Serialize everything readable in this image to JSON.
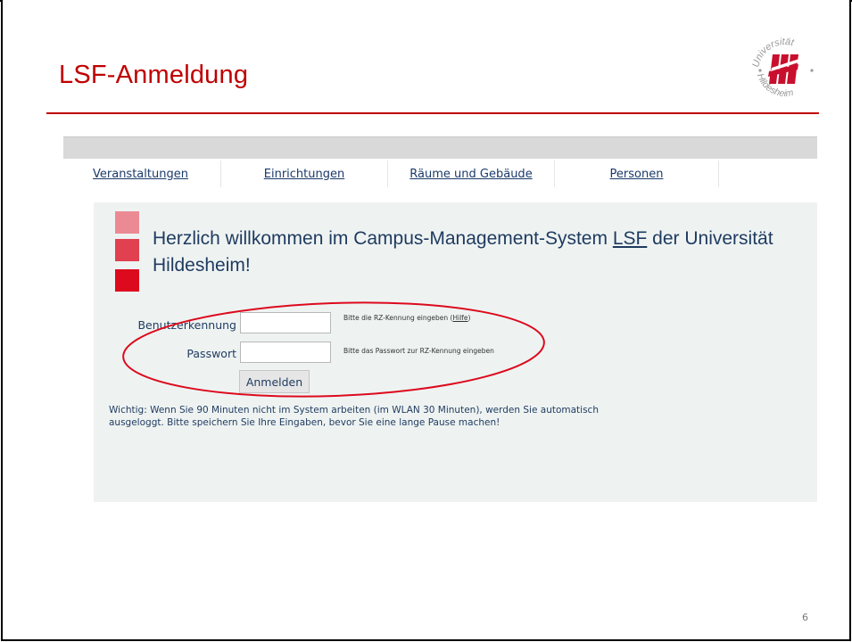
{
  "slide": {
    "title": "LSF-Anmeldung",
    "page_number": "6"
  },
  "logo": {
    "text_top": "Universität",
    "text_bottom": "Hildesheim",
    "mark_color": "#c8102e"
  },
  "nav": {
    "tabs": [
      {
        "label": "Veranstaltungen"
      },
      {
        "label": "Einrichtungen"
      },
      {
        "label": "Räume und Gebäude"
      },
      {
        "label": "Personen"
      }
    ]
  },
  "welcome": {
    "prefix": "Herzlich willkommen im Campus-Management-System ",
    "lsf_link": "LSF",
    "suffix": " der Universität Hildesheim!"
  },
  "login": {
    "username_label": "Benutzerkennung",
    "username_value": "",
    "username_hint_prefix": "Bitte die RZ-Kennung eingeben (",
    "username_hint_link": "Hilfe",
    "username_hint_suffix": ")",
    "password_label": "Passwort",
    "password_value": "",
    "password_hint": "Bitte das Passwort zur RZ-Kennung eingeben",
    "submit_label": "Anmelden"
  },
  "notice": {
    "text": "Wichtig: Wenn Sie 90 Minuten nicht im System arbeiten (im WLAN 30 Minuten), werden Sie automatisch ausgeloggt. Bitte speichern Sie Ihre Eingaben, bevor Sie eine lange Pause machen!"
  },
  "colors": {
    "accent_red": "#c00000",
    "panel_bg": "#eef3f2",
    "text_navy": "#1f3a5f",
    "square_light": "#ec8a94",
    "square_mid": "#e0404f",
    "square_dark": "#dd0a1d",
    "annotation_ellipse": "#dd0a1d"
  }
}
